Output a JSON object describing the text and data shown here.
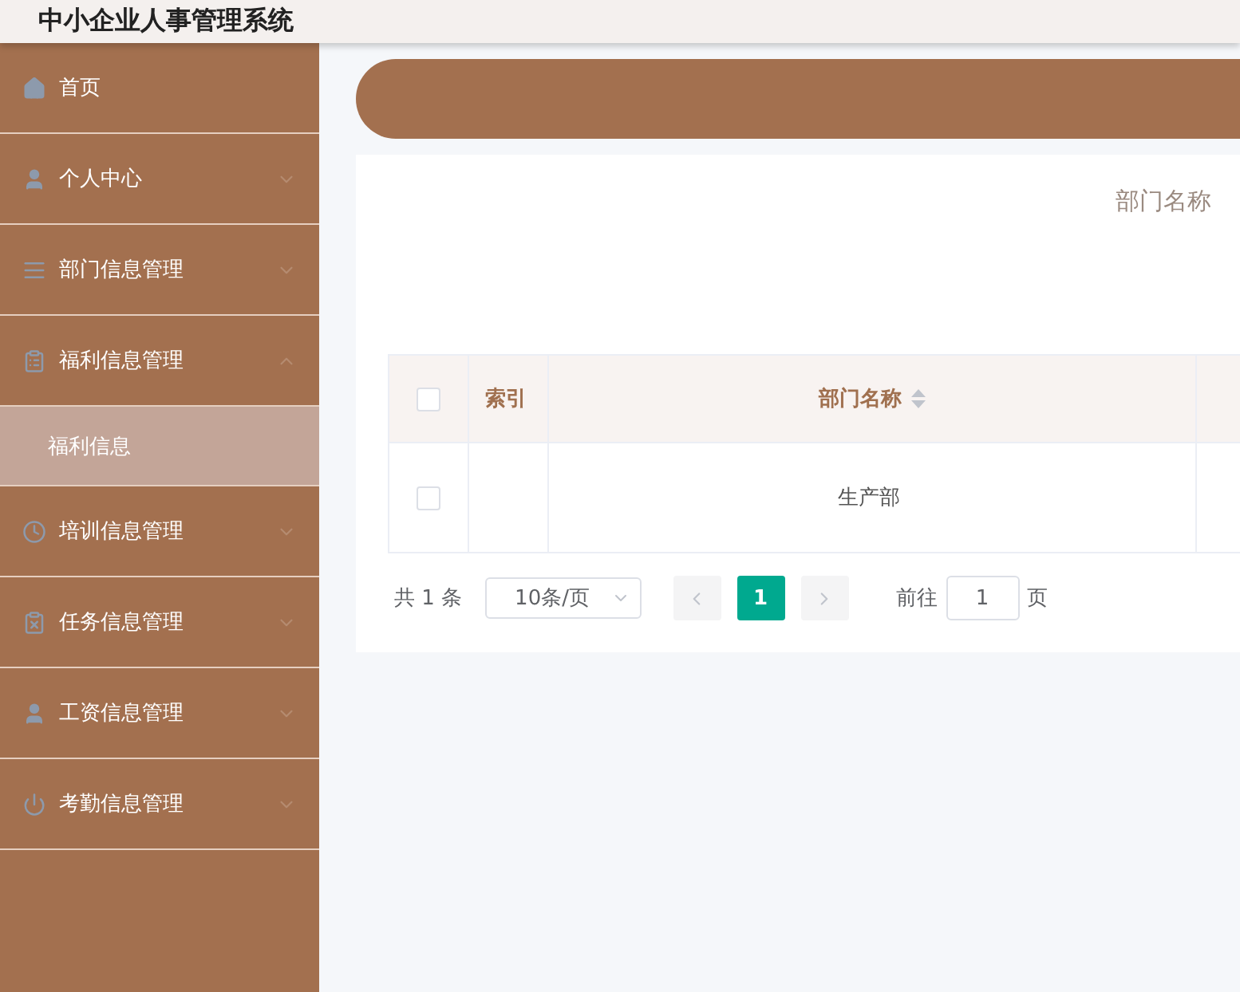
{
  "header": {
    "title": "中小企业人事管理系统"
  },
  "sidebar": {
    "items": [
      {
        "label": "首页",
        "kind": "link"
      },
      {
        "label": "个人中心",
        "kind": "menu",
        "expanded": false
      },
      {
        "label": "部门信息管理",
        "kind": "menu",
        "expanded": false
      },
      {
        "label": "福利信息管理",
        "kind": "menu",
        "expanded": true,
        "children": [
          {
            "label": "福利信息",
            "selected": true
          }
        ]
      },
      {
        "label": "培训信息管理",
        "kind": "menu",
        "expanded": false
      },
      {
        "label": "任务信息管理",
        "kind": "menu",
        "expanded": false
      },
      {
        "label": "工资信息管理",
        "kind": "menu",
        "expanded": false
      },
      {
        "label": "考勤信息管理",
        "kind": "menu",
        "expanded": false
      }
    ]
  },
  "search": {
    "label": "部门名称"
  },
  "table": {
    "all_checked": false,
    "columns": [
      {
        "label": "索引",
        "sortable": false
      },
      {
        "label": "部门名称",
        "sortable": true
      }
    ],
    "rows": [
      {
        "checked": false,
        "department": "生产部"
      }
    ]
  },
  "pagination": {
    "total": "共 1 条",
    "page_size": "10条/页",
    "pages": [
      {
        "label": "1",
        "selected": true
      }
    ],
    "goto_label": "前往",
    "goto_value": "1",
    "goto_suffix": "页"
  }
}
